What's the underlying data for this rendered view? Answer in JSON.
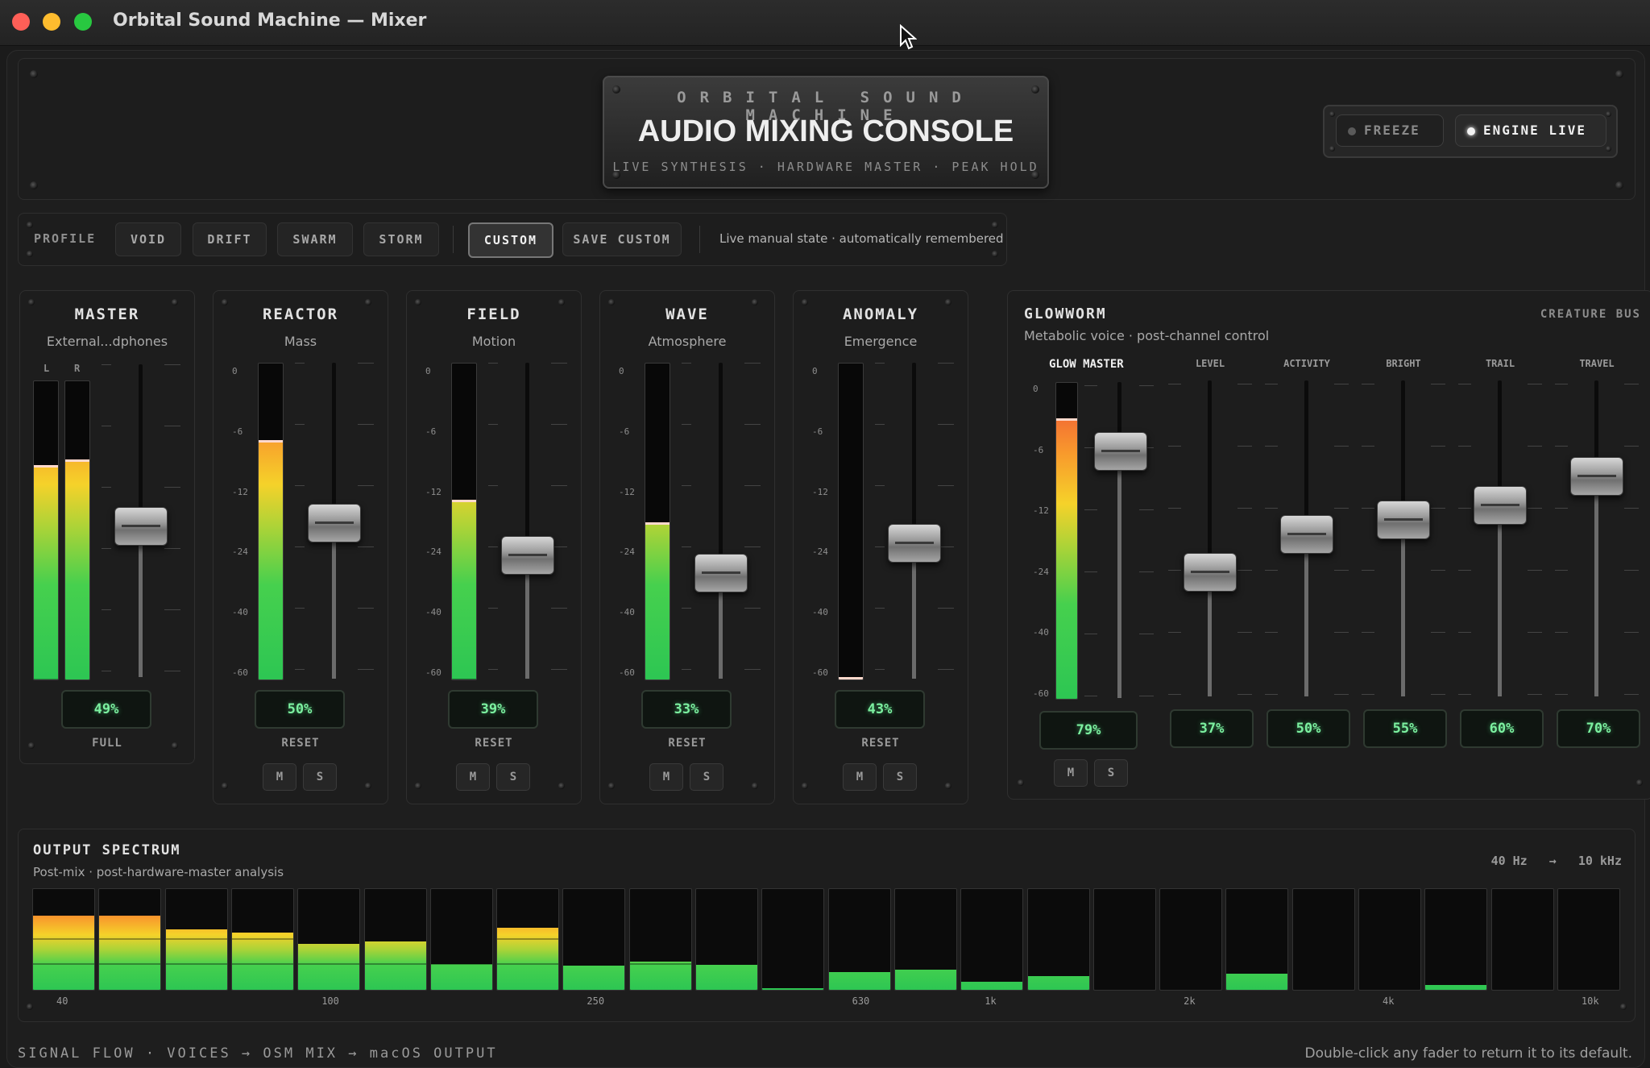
{
  "window": {
    "title": "Orbital Sound Machine — Mixer"
  },
  "header": {
    "kicker": "ORBITAL SOUND MACHINE",
    "title": "AUDIO MIXING CONSOLE",
    "subtitle": "LIVE SYNTHESIS · HARDWARE MASTER · PEAK HOLD",
    "freeze_label": "FREEZE",
    "engine_label": "ENGINE LIVE"
  },
  "profile": {
    "label": "PROFILE",
    "buttons": [
      "VOID",
      "DRIFT",
      "SWARM",
      "STORM",
      "CUSTOM",
      "SAVE CUSTOM"
    ],
    "active": "CUSTOM",
    "status": "Live manual state · automatically remembered"
  },
  "scale": [
    "0",
    "-6",
    "-12",
    "-24",
    "-40",
    "-60"
  ],
  "channels": [
    {
      "name": "MASTER",
      "source": "External...dphones",
      "level": "49%",
      "action": "FULL",
      "meter_l": 0.71,
      "meter_r": 0.73,
      "fader": 0.49,
      "stereo": true,
      "L": "L",
      "R": "R"
    },
    {
      "name": "REACTOR",
      "source": "Mass",
      "level": "50%",
      "action": "RESET",
      "meter": 0.75,
      "fader": 0.5,
      "mute": "M",
      "solo": "S"
    },
    {
      "name": "FIELD",
      "source": "Motion",
      "level": "39%",
      "action": "RESET",
      "meter": 0.56,
      "fader": 0.39,
      "mute": "M",
      "solo": "S"
    },
    {
      "name": "WAVE",
      "source": "Atmosphere",
      "level": "33%",
      "action": "RESET",
      "meter": 0.49,
      "fader": 0.33,
      "mute": "M",
      "solo": "S"
    },
    {
      "name": "ANOMALY",
      "source": "Emergence",
      "level": "43%",
      "action": "RESET",
      "meter": 0.0,
      "fader": 0.43,
      "mute": "M",
      "solo": "S"
    }
  ],
  "glowworm": {
    "title": "GLOWWORM",
    "subtitle": "Metabolic voice · post-channel control",
    "tag": "CREATURE BUS",
    "master_label": "GLOW MASTER",
    "master_level": "79%",
    "master_meter": 0.88,
    "master_fader": 0.79,
    "mute": "M",
    "solo": "S",
    "controls": [
      {
        "label": "LEVEL",
        "value": "37%",
        "fader": 0.37
      },
      {
        "label": "ACTIVITY",
        "value": "50%",
        "fader": 0.5
      },
      {
        "label": "BRIGHT",
        "value": "55%",
        "fader": 0.55
      },
      {
        "label": "TRAIL",
        "value": "60%",
        "fader": 0.6
      },
      {
        "label": "TRAVEL",
        "value": "70%",
        "fader": 0.7
      }
    ]
  },
  "spectrum": {
    "title": "OUTPUT SPECTRUM",
    "subtitle": "Post-mix · post-hardware-master analysis",
    "range_lo": "40 Hz",
    "arrow": "→",
    "range_hi": "10 kHz",
    "bands": [
      0.74,
      0.74,
      0.6,
      0.57,
      0.46,
      0.48,
      0.26,
      0.62,
      0.24,
      0.28,
      0.25,
      0.02,
      0.18,
      0.2,
      0.08,
      0.14,
      0.0,
      0.0,
      0.16,
      0.0,
      0.0,
      0.05,
      0.0,
      0.0
    ],
    "freq_labels": [
      {
        "band": 0,
        "text": "40"
      },
      {
        "band": 4,
        "text": "100"
      },
      {
        "band": 8,
        "text": "250"
      },
      {
        "band": 12,
        "text": "630"
      },
      {
        "band": 14,
        "text": "1k"
      },
      {
        "band": 17,
        "text": "2k"
      },
      {
        "band": 20,
        "text": "4k"
      },
      {
        "band": 23,
        "text": "10k"
      }
    ]
  },
  "footer": {
    "signal_flow": "SIGNAL FLOW · VOICES → OSM MIX → macOS OUTPUT",
    "hint": "Double-click any fader to return it to its default."
  }
}
